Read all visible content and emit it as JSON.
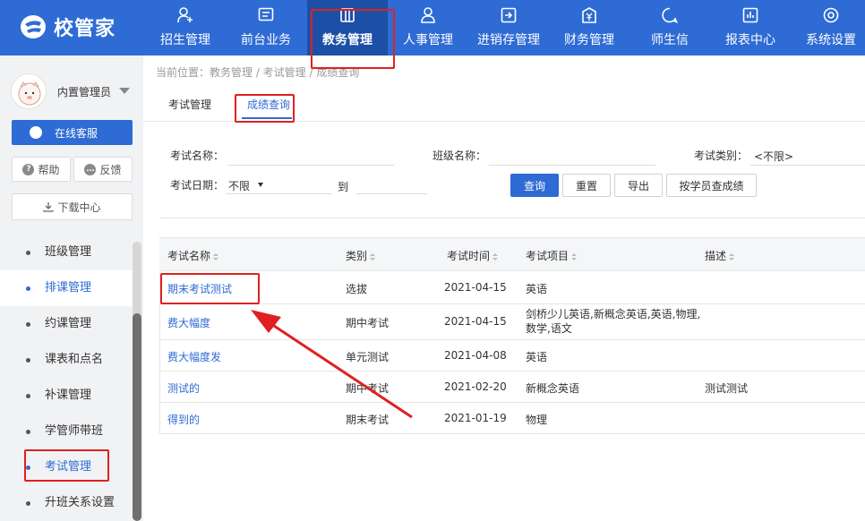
{
  "app": {
    "logo_text": "校管家"
  },
  "nav": {
    "items": [
      {
        "label": "招生管理",
        "icon": "user-plus-icon"
      },
      {
        "label": "前台业务",
        "icon": "screen-icon"
      },
      {
        "label": "教务管理",
        "icon": "book-icon",
        "active": true
      },
      {
        "label": "人事管理",
        "icon": "person-icon"
      },
      {
        "label": "进销存管理",
        "icon": "inbox-icon"
      },
      {
        "label": "财务管理",
        "icon": "money-icon"
      },
      {
        "label": "师生信",
        "icon": "chat-icon"
      },
      {
        "label": "报表中心",
        "icon": "chart-icon"
      },
      {
        "label": "系统设置",
        "icon": "gear-icon"
      }
    ]
  },
  "sidebar": {
    "user_name": "内置管理员",
    "service_label": "在线客服",
    "help_label": "帮助",
    "feedback_label": "反馈",
    "download_label": "下载中心",
    "menu": [
      {
        "label": "班级管理"
      },
      {
        "label": "排课管理",
        "highlight": true
      },
      {
        "label": "约课管理"
      },
      {
        "label": "课表和点名"
      },
      {
        "label": "补课管理"
      },
      {
        "label": "学管师带班"
      },
      {
        "label": "考试管理",
        "selected": true
      },
      {
        "label": "升班关系设置"
      }
    ]
  },
  "breadcrumb": "当前位置：教务管理 / 考试管理 / 成绩查询",
  "tabs": [
    {
      "label": "考试管理"
    },
    {
      "label": "成绩查询",
      "active": true
    }
  ],
  "filters": {
    "exam_name_label": "考试名称：",
    "exam_name_value": "",
    "class_name_label": "班级名称：",
    "class_name_value": "",
    "exam_type_label": "考试类别：",
    "exam_type_value": "<不限>",
    "exam_date_label": "考试日期：",
    "exam_date_value": "不限",
    "to_label": "到"
  },
  "actions": {
    "query": "查询",
    "reset": "重置",
    "export": "导出",
    "by_student": "按学员查成绩"
  },
  "table": {
    "headers": [
      "考试名称",
      "类别",
      "考试时间",
      "考试项目",
      "描述"
    ],
    "rows": [
      {
        "name": "期末考试测试",
        "type": "选拔",
        "date": "2021-04-15",
        "subjects": "英语",
        "desc": ""
      },
      {
        "name": "费大幅度",
        "type": "期中考试",
        "date": "2021-04-15",
        "subjects": "剑桥少儿英语,新概念英语,英语,物理,数学,语文",
        "desc": ""
      },
      {
        "name": "费大幅度发",
        "type": "单元测试",
        "date": "2021-04-08",
        "subjects": "英语",
        "desc": ""
      },
      {
        "name": "测试的",
        "type": "期中考试",
        "date": "2021-02-20",
        "subjects": "新概念英语",
        "desc": "测试测试"
      },
      {
        "name": "得到的",
        "type": "期末考试",
        "date": "2021-01-19",
        "subjects": "物理",
        "desc": ""
      }
    ]
  },
  "colors": {
    "primary": "#2e6bd4",
    "nav_active": "#1c4fa6",
    "annotation": "#e02020"
  }
}
